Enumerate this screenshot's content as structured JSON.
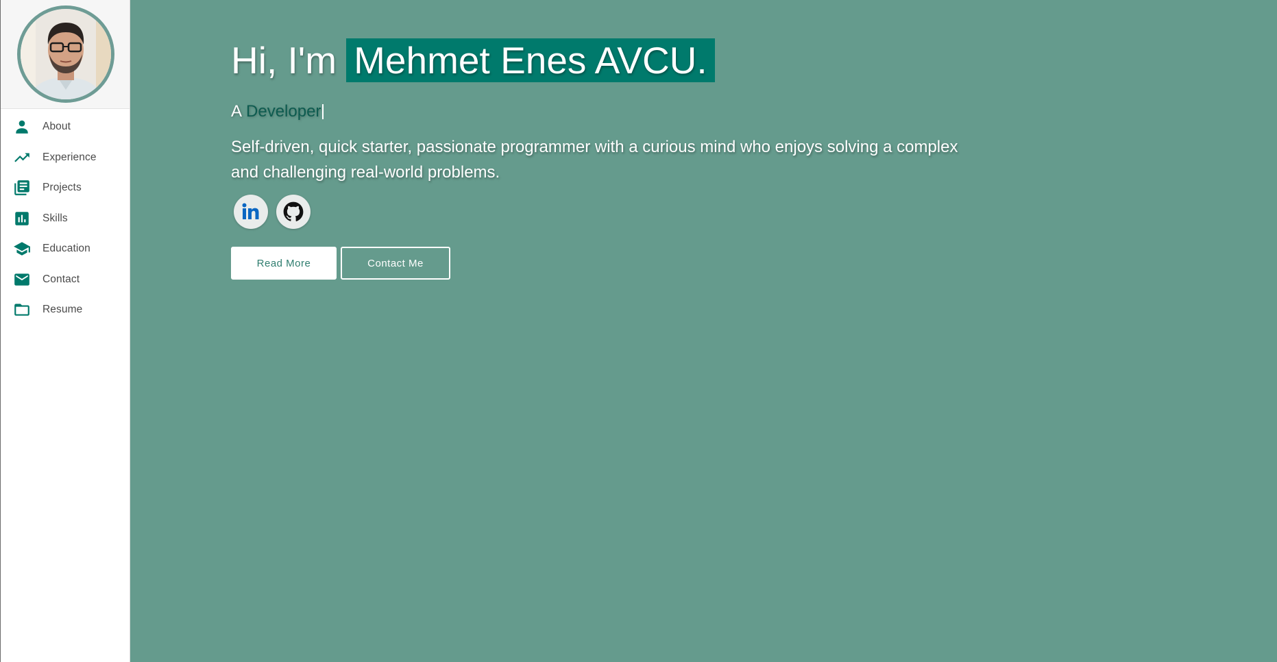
{
  "colors": {
    "background": "#659b8d",
    "accent": "#007a6c",
    "sidebar_bg": "#ffffff",
    "icon": "#00796b"
  },
  "sidebar": {
    "avatar_alt": "profile photo",
    "items": [
      {
        "label": "About",
        "icon": "person-icon"
      },
      {
        "label": "Experience",
        "icon": "trending-up-icon"
      },
      {
        "label": "Projects",
        "icon": "library-books-icon"
      },
      {
        "label": "Skills",
        "icon": "bar-chart-icon"
      },
      {
        "label": "Education",
        "icon": "graduation-cap-icon"
      },
      {
        "label": "Contact",
        "icon": "mail-icon"
      },
      {
        "label": "Resume",
        "icon": "folder-icon"
      }
    ]
  },
  "hero": {
    "greeting": "Hi, I'm",
    "name": "Mehmet Enes AVCU.",
    "role_prefix": "A",
    "role_word": "Developer",
    "bio": "Self-driven, quick starter, passionate programmer with a curious mind who enjoys solving a complex and challenging real-world problems.",
    "socials": [
      {
        "name": "linkedin-icon",
        "label": "in"
      },
      {
        "name": "github-icon"
      }
    ],
    "buttons": {
      "read_more": "Read More",
      "contact_me": "Contact Me"
    }
  }
}
